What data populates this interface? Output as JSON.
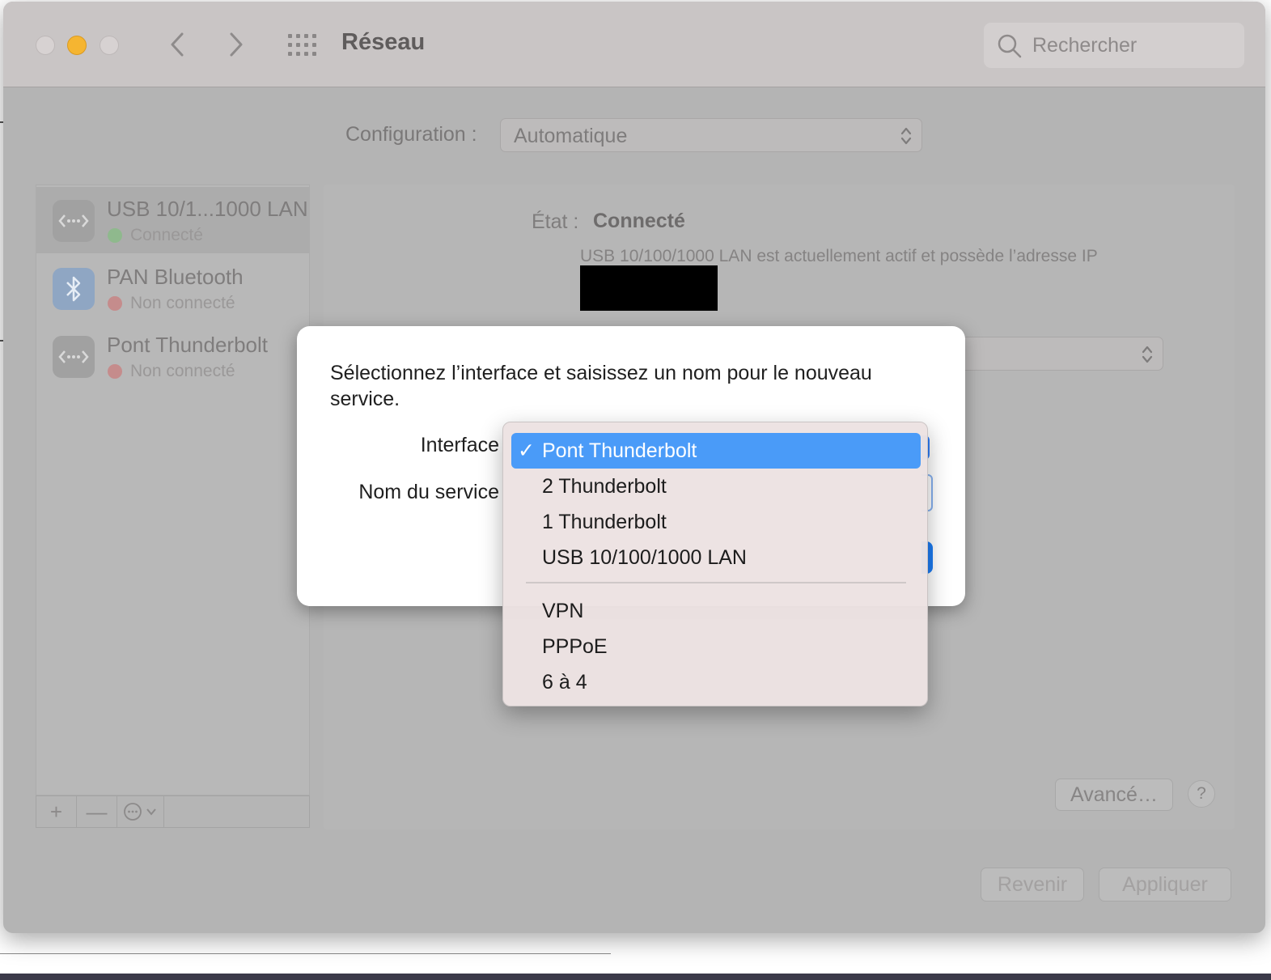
{
  "window": {
    "title": "Réseau",
    "search_placeholder": "Rechercher"
  },
  "configuration": {
    "label": "Configuration :",
    "value": "Automatique"
  },
  "services": [
    {
      "name": "USB 10/1...1000 LAN",
      "status": "Connecté",
      "status_color": "#8fb98d",
      "icon": "ethernet-icon",
      "selected": true
    },
    {
      "name": "PAN Bluetooth",
      "status": "Non connecté",
      "status_color": "#c58c8c",
      "icon": "bluetooth-icon",
      "selected": false
    },
    {
      "name": "Pont Thunderbolt",
      "status": "Non connecté",
      "status_color": "#c58c8c",
      "icon": "ethernet-icon",
      "selected": false
    }
  ],
  "sidebar_toolbar": {
    "add": "+",
    "remove": "—"
  },
  "detail": {
    "state_label": "État :",
    "state_value": "Connecté",
    "description": "USB 10/100/1000 LAN est actuellement actif et possède l’adresse IP",
    "advanced_button": "Avancé…",
    "help_button": "?",
    "revert_button": "Revenir",
    "apply_button": "Appliquer"
  },
  "dialog": {
    "message": "Sélectionnez l’interface et saisissez un nom pour le nouveau service.",
    "interface_label": "Interface",
    "service_name_label": "Nom du service"
  },
  "interface_menu": {
    "selected": "Pont Thunderbolt",
    "check": "✓",
    "group1": [
      "Pont Thunderbolt",
      "2 Thunderbolt",
      "1 Thunderbolt",
      "USB 10/100/1000 LAN"
    ],
    "group2": [
      "VPN",
      "PPPoE",
      "6 à 4"
    ]
  },
  "colors": {
    "menu_highlight": "#4a9bf8",
    "accent_blue": "#1c7bf2",
    "minimize_yellow": "#f5b531"
  }
}
